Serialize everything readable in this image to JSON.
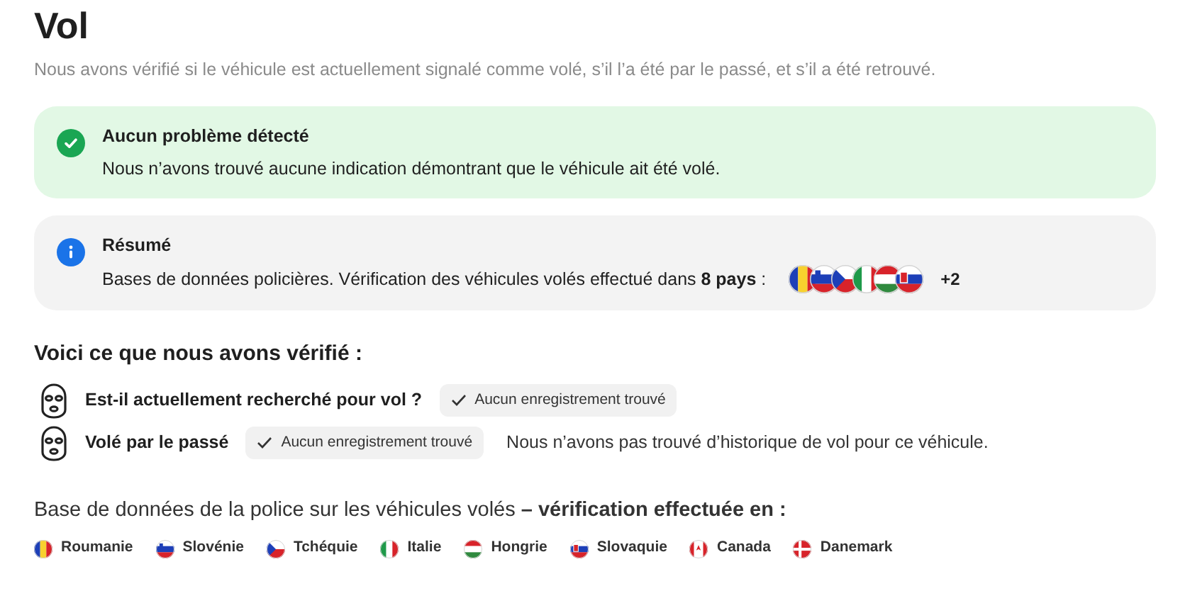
{
  "title": "Vol",
  "subtitle": "Nous avons vérifié si le véhicule est actuellement signalé comme volé, s’il l’a été par le passé, et s’il a été retrouvé.",
  "alerts": [
    {
      "kind": "success",
      "title": "Aucun problème détecté",
      "text": "Nous n’avons trouvé aucune indication démontrant que le véhicule ait été volé."
    },
    {
      "kind": "info",
      "title": "Résumé",
      "text": "Bases de données policières. Vérification des véhicules volés effectué dans **8 pays** :",
      "flags": [
        {
          "kind": "ro"
        },
        {
          "kind": "si"
        },
        {
          "kind": "cz"
        },
        {
          "kind": "it"
        },
        {
          "kind": "hu"
        },
        {
          "kind": "sk"
        }
      ],
      "more": "+2"
    }
  ],
  "checks_heading": "Voici ce que nous avons vérifié :",
  "checks": [
    {
      "label": "Est-il actuellement recherché pour vol ?",
      "badge": "Aucun enregistrement trouvé"
    },
    {
      "label": "Volé par le passé",
      "badge": "Aucun enregistrement trouvé",
      "note": "Nous n’avons pas trouvé d’historique de vol pour ce véhicule."
    }
  ],
  "database_heading": "Base de données de la police sur les véhicules volés **– vérification effectuée en :**",
  "countries": [
    {
      "kind": "ro",
      "name": "Roumanie"
    },
    {
      "kind": "si",
      "name": "Slovénie"
    },
    {
      "kind": "cz",
      "name": "Tchéquie"
    },
    {
      "kind": "it",
      "name": "Italie"
    },
    {
      "kind": "hu",
      "name": "Hongrie"
    },
    {
      "kind": "sk",
      "name": "Slovaquie"
    },
    {
      "kind": "ca",
      "name": "Canada"
    },
    {
      "kind": "dk",
      "name": "Danemark"
    }
  ]
}
